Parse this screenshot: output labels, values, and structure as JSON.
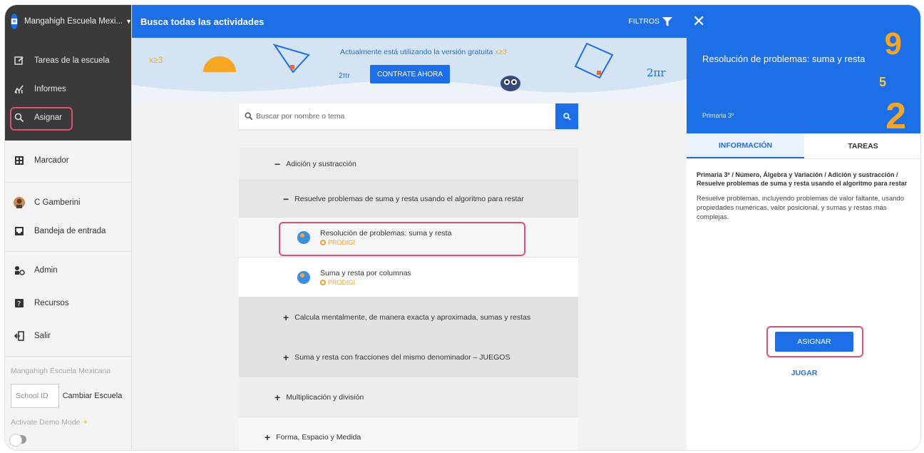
{
  "sidebar": {
    "school_name": "Mangahigh Escuela Mexi...",
    "items_dark": [
      {
        "label": "Tareas de la escuela",
        "icon": "edit-icon"
      },
      {
        "label": "Informes",
        "icon": "chart-icon"
      },
      {
        "label": "Asignar",
        "icon": "search-icon"
      }
    ],
    "items_light_1": [
      {
        "label": "Marcador",
        "icon": "grid-icon"
      }
    ],
    "items_light_2": [
      {
        "label": "C Gamberini",
        "icon": "avatar-icon"
      },
      {
        "label": "Bandeja de entrada",
        "icon": "inbox-icon"
      }
    ],
    "items_light_3": [
      {
        "label": "Admin",
        "icon": "admin-icon"
      },
      {
        "label": "Recursos",
        "icon": "resources-icon"
      },
      {
        "label": "Salir",
        "icon": "logout-icon"
      }
    ],
    "footer_school": "Mangahigh Escuela Mexicana",
    "school_id_placeholder": "School ID",
    "change_school": "Cambiar Escuela",
    "demo_mode": "Activate Demo Mode"
  },
  "main": {
    "title": "Busca todas las actividades",
    "filters": "FILTROS",
    "banner": {
      "notice": "Actualmente está utilizando la versión gratuita",
      "cta": "CONTRATE AHORA",
      "deco_left": "x≥3",
      "deco_mid": "2πr",
      "deco_right": "2πr",
      "deco_notice": "x≥3"
    },
    "search_placeholder": "Buscar por nombre o tema",
    "tree": {
      "level1_open": "Adición y sustracción",
      "level2_open": "Resuelve problemas de suma y resta usando el algoritmo para restar",
      "activities": [
        {
          "title": "Resolución de problemas: suma y resta",
          "badge": "PRODIGI"
        },
        {
          "title": "Suma y resta por columnas",
          "badge": "PRODIGI"
        }
      ],
      "level2_closed": [
        "Calcula mentalmente, de manera exacta y aproximada, sumas y restas",
        "Suma y resta con fracciones del mismo denominador – JUEGOS"
      ],
      "level1_closed": [
        "Multiplicación y división",
        "Forma, Espacio y Medida"
      ]
    }
  },
  "panel": {
    "title": "Resolución de problemas: suma y resta",
    "grade": "Primaria 3º",
    "tabs": [
      "INFORMACIÓN",
      "TAREAS"
    ],
    "path": "Primaria 3º / Número, Álgebra y Variación / Adición y sustracción / Resuelve problemas de suma y resta usando el algoritmo para restar",
    "description": "Resuelve problemas, incluyendo problemas de valor faltante, usando propiedades numéricas, valor posicional, y sumas y restas más complejas.",
    "assign": "ASIGNAR",
    "play": "JUGAR"
  },
  "colors": {
    "primary": "#1c6fe6",
    "sidebar_dark": "#3a3a3a",
    "highlight": "#e0506f",
    "accent": "#f6a623"
  }
}
